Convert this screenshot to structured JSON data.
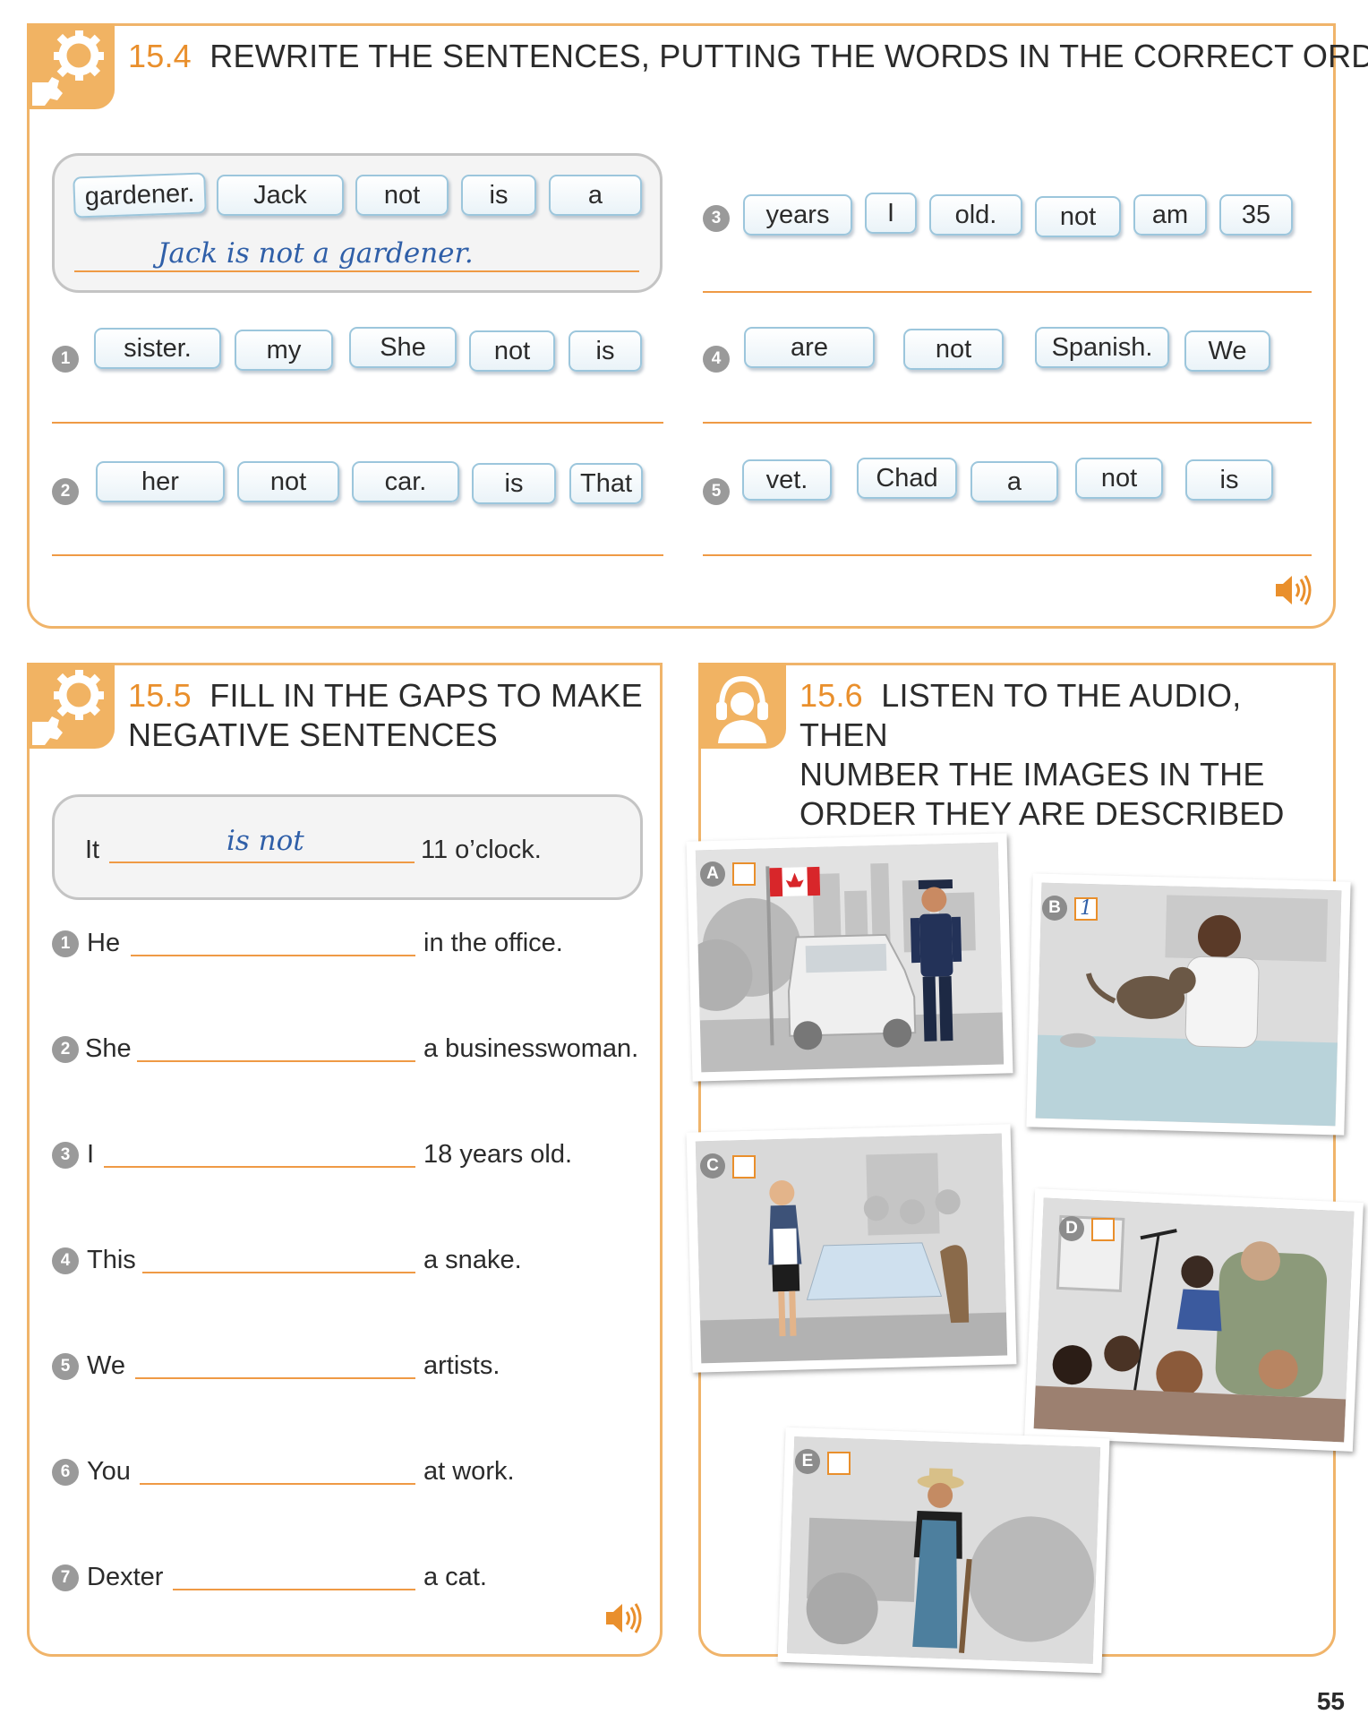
{
  "colors": {
    "accent": "#e98f2c",
    "panel_border": "#f0b46a",
    "chip_border": "#9cc6dc",
    "handwriting": "#2f5fa8"
  },
  "ex154": {
    "number": "15.4",
    "title": "REWRITE THE SENTENCES, PUTTING THE WORDS IN THE CORRECT ORDER",
    "example": {
      "words": [
        "gardener.",
        "Jack",
        "not",
        "is",
        "a"
      ],
      "answer": "Jack is not a gardener."
    },
    "items": [
      {
        "num": "1",
        "words": [
          "sister.",
          "my",
          "She",
          "not",
          "is"
        ]
      },
      {
        "num": "2",
        "words": [
          "her",
          "not",
          "car.",
          "is",
          "That"
        ]
      },
      {
        "num": "3",
        "words": [
          "years",
          "I",
          "old.",
          "not",
          "am",
          "35"
        ]
      },
      {
        "num": "4",
        "words": [
          "are",
          "not",
          "Spanish.",
          "We"
        ]
      },
      {
        "num": "5",
        "words": [
          "vet.",
          "Chad",
          "a",
          "not",
          "is"
        ]
      }
    ],
    "audio_icon": "speaker-icon"
  },
  "ex155": {
    "number": "15.5",
    "title_line1": "FILL IN THE GAPS TO MAKE",
    "title_line2": "NEGATIVE SENTENCES",
    "example": {
      "start": "It",
      "answer": "is not",
      "end": "11 o’clock."
    },
    "items": [
      {
        "num": "1",
        "start": "He",
        "end": "in the office."
      },
      {
        "num": "2",
        "start": "She",
        "end": "a businesswoman."
      },
      {
        "num": "3",
        "start": "I",
        "end": "18 years old."
      },
      {
        "num": "4",
        "start": "This",
        "end": "a snake."
      },
      {
        "num": "5",
        "start": "We",
        "end": "artists."
      },
      {
        "num": "6",
        "start": "You",
        "end": "at work."
      },
      {
        "num": "7",
        "start": "Dexter",
        "end": "a cat."
      }
    ],
    "audio_icon": "speaker-icon"
  },
  "ex156": {
    "number": "15.6",
    "title_line1": "LISTEN TO THE AUDIO, THEN",
    "title_line2": "NUMBER THE IMAGES IN THE",
    "title_line3": "ORDER THEY ARE DESCRIBED",
    "images": [
      {
        "letter": "A",
        "answer": "",
        "depicts": "police-officer"
      },
      {
        "letter": "B",
        "answer": "1",
        "depicts": "vet-with-cat"
      },
      {
        "letter": "C",
        "answer": "",
        "depicts": "waitress"
      },
      {
        "letter": "D",
        "answer": "",
        "depicts": "teacher-with-children"
      },
      {
        "letter": "E",
        "answer": "",
        "depicts": "farmer"
      }
    ]
  },
  "page_number": "55"
}
